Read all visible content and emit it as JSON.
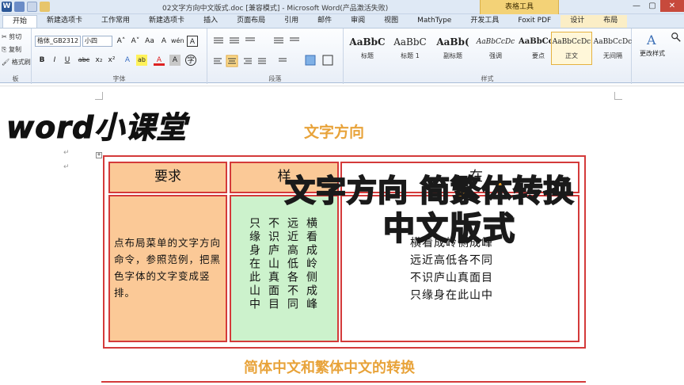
{
  "window": {
    "title": "02文字方向中文版式.doc [兼容模式] - Microsoft Word(产品激活失败)",
    "context_group": "表格工具",
    "app_icon_letter": "W",
    "controls": [
      "—",
      "▢",
      "✕"
    ]
  },
  "tabs": [
    {
      "label": "开始",
      "active": true
    },
    {
      "label": "新建选项卡"
    },
    {
      "label": "工作常用"
    },
    {
      "label": "新建选项卡"
    },
    {
      "label": "插入"
    },
    {
      "label": "页面布局"
    },
    {
      "label": "引用"
    },
    {
      "label": "邮件"
    },
    {
      "label": "审阅"
    },
    {
      "label": "视图"
    },
    {
      "label": "MathType"
    },
    {
      "label": "开发工具"
    },
    {
      "label": "Foxit PDF"
    },
    {
      "label": "设计",
      "contextual": true
    },
    {
      "label": "布局",
      "contextual": true
    }
  ],
  "ribbon": {
    "clipboard": {
      "cut": "剪切",
      "copy": "复制",
      "format_painter": "格式刷",
      "label": "板"
    },
    "font": {
      "name": "楷体_GB2312",
      "size": "小四",
      "label": "字体",
      "grow": "A˄",
      "shrink": "A˅",
      "case": "Aa",
      "clear": "A",
      "wen": "wén",
      "char_border": "A",
      "bold": "B",
      "italic": "I",
      "underline": "U",
      "strike": "abc",
      "sub": "x₂",
      "sup": "x²",
      "effects": "A",
      "highlight": "ab",
      "color": "A",
      "shading": "A",
      "circle": "字"
    },
    "paragraph": {
      "label": "段落"
    },
    "styles": {
      "label": "样式",
      "items": [
        {
          "preview": "AaBbC",
          "name": "标题"
        },
        {
          "preview": "AaBbC",
          "name": "标题 1"
        },
        {
          "preview": "AaBb(",
          "name": "副标题"
        },
        {
          "preview": "AaBbCcDc",
          "name": "强调"
        },
        {
          "preview": "AaBbCcD",
          "name": "要点"
        },
        {
          "preview": "AaBbCcDc",
          "name": "正文",
          "selected": true
        },
        {
          "preview": "AaBbCcDc",
          "name": "无间隔"
        }
      ]
    },
    "change_styles": "更改样式"
  },
  "document": {
    "brand": "word小课堂",
    "heading": "文字方向",
    "table": {
      "headers": [
        "要求",
        "样",
        "在"
      ],
      "requirement": "点布局菜单的文字方向命令，参照范例，把黑色字体的文字变成竖排。",
      "vertical_columns": [
        "横看成岭侧成峰",
        "远近高低各不同",
        "不识庐山真面目",
        "只缘身在此山中"
      ],
      "horizontal_lines": [
        "横看成岭侧成峰",
        "远近高低各不同",
        "不识庐山真面目",
        "只缘身在此山中"
      ]
    },
    "overlay_line1": "文字方向 简繁体转换",
    "overlay_line2": "中文版式",
    "caption": "简体中文和繁体中文的转换"
  },
  "colors": {
    "accent": "#e8a33a",
    "table_border": "#d43a3a",
    "header_fill": "#fbc997",
    "green_fill": "#ccf2cc"
  }
}
